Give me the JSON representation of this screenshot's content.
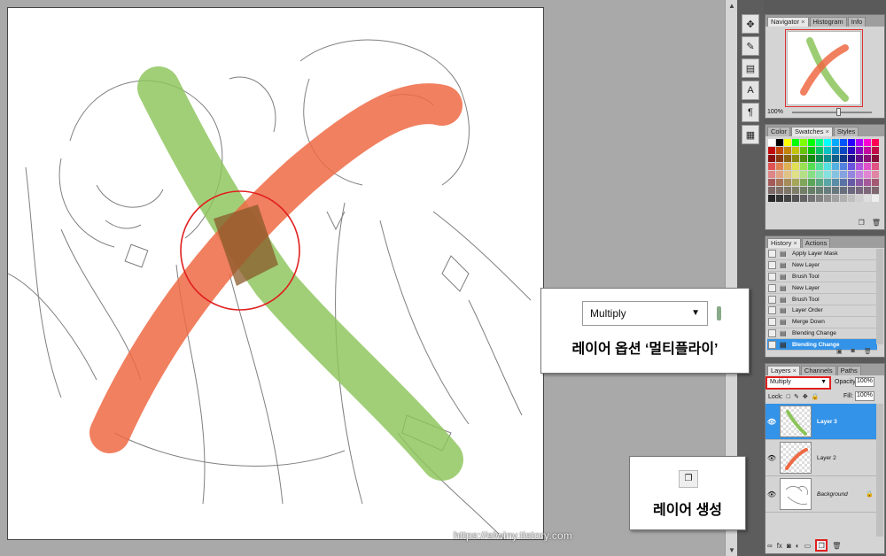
{
  "watermark": "https://elwiny.tistory.com",
  "tools": [
    {
      "icon": "move-icon",
      "glyph": "✥"
    },
    {
      "icon": "brush-settings-icon",
      "glyph": "✎"
    },
    {
      "icon": "clone-source-icon",
      "glyph": "▤"
    },
    {
      "icon": "character-icon",
      "glyph": "A"
    },
    {
      "icon": "paragraph-icon",
      "glyph": "¶"
    },
    {
      "icon": "notes-icon",
      "glyph": "▦"
    }
  ],
  "navigator": {
    "tabs": [
      "Navigator",
      "Histogram",
      "Info"
    ],
    "zoom": "100%"
  },
  "swatches_panel": {
    "tabs": [
      "Color",
      "Swatches",
      "Styles"
    ]
  },
  "history_panel": {
    "tabs": [
      "History",
      "Actions"
    ],
    "items": [
      {
        "label": "Apply Layer Mask",
        "active": false
      },
      {
        "label": "New Layer",
        "active": false
      },
      {
        "label": "Brush Tool",
        "active": false
      },
      {
        "label": "New Layer",
        "active": false
      },
      {
        "label": "Brush Tool",
        "active": false
      },
      {
        "label": "Layer Order",
        "active": false
      },
      {
        "label": "Merge Down",
        "active": false
      },
      {
        "label": "Blending Change",
        "active": false
      },
      {
        "label": "Blending Change",
        "active": true
      }
    ]
  },
  "layers_panel": {
    "tabs": [
      "Layers",
      "Channels",
      "Paths"
    ],
    "blend_mode": "Multiply",
    "opacity_label": "Opacity:",
    "opacity": "100%",
    "lock_label": "Lock:",
    "fill_label": "Fill:",
    "fill": "100%",
    "layers": [
      {
        "name": "Layer 3",
        "selected": true,
        "visible": true
      },
      {
        "name": "Layer 2",
        "selected": false,
        "visible": true
      },
      {
        "name": "Background",
        "selected": false,
        "visible": true,
        "locked": true
      }
    ]
  },
  "callouts": {
    "multiply": {
      "select_value": "Multiply",
      "caption": "레이어 옵션 ‘멀티플라이’"
    },
    "new_layer": {
      "caption": "레이어 생성"
    }
  },
  "colors": {
    "highlight_red": "#e02020",
    "selection_blue": "#3393e8",
    "stroke_green": "#8cc45a",
    "stroke_orange": "#ee6a44"
  }
}
